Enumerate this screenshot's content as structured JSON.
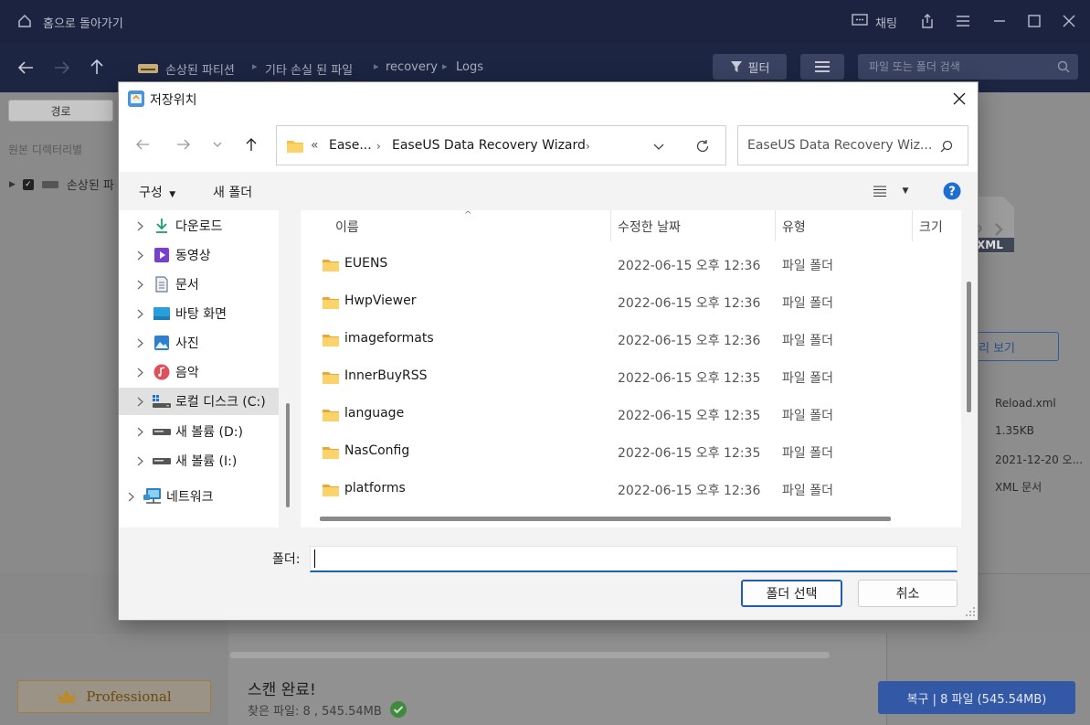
{
  "app": {
    "home_label": "홈으로 돌아가기",
    "chat_label": "채팅",
    "breadcrumb": [
      "손상된 파티션",
      "기타 손실 된 파일",
      "recovery",
      "Logs"
    ],
    "filter_label": "필터",
    "search_placeholder": "파일 또는 폴더 검색",
    "path_tab": "경로",
    "source_dir_label": "원본 디렉터리별",
    "tree_root_label": "손상된 파",
    "preview_label": "리 보기",
    "file_meta": {
      "name": "Reload.xml",
      "size": "1.35KB",
      "date": "2021-12-20 오...",
      "type": "XML 문서",
      "badge": "XML"
    },
    "professional_label": "Professional",
    "scan_title": "스캔 완료!",
    "scan_sub": "찾은 파일: 8 , 545.54MB",
    "recover_button": "복구 | 8 파일 (545.54MB)"
  },
  "dialog": {
    "title": "저장위치",
    "address": {
      "prefix": "«",
      "crumbs": [
        "Ease...",
        "EaseUS Data Recovery Wizard"
      ]
    },
    "search_placeholder": "EaseUS Data Recovery Wiz...",
    "organize_label": "구성",
    "new_folder_label": "새 폴더",
    "tree": [
      {
        "label": "다운로드",
        "icon": "download-icon",
        "color": "#1a9e6a"
      },
      {
        "label": "동영상",
        "icon": "video-icon",
        "color": "#7b3fd0"
      },
      {
        "label": "문서",
        "icon": "document-icon",
        "color": "#6b7a8c"
      },
      {
        "label": "바탕 화면",
        "icon": "desktop-icon",
        "color": "#2a9ed8"
      },
      {
        "label": "사진",
        "icon": "pictures-icon",
        "color": "#2e7fd1"
      },
      {
        "label": "음악",
        "icon": "music-icon",
        "color": "#e0505a"
      },
      {
        "label": "로컬 디스크 (C:)",
        "icon": "local-disk-icon",
        "color": "#555555",
        "selected": true
      },
      {
        "label": "새 볼륨 (D:)",
        "icon": "drive-icon",
        "color": "#555555"
      },
      {
        "label": "새 볼륨 (I:)",
        "icon": "drive-icon",
        "color": "#555555"
      },
      {
        "label": "네트워크",
        "icon": "network-icon",
        "color": "#2a7fc0"
      }
    ],
    "columns": {
      "name": "이름",
      "date": "수정한 날짜",
      "type": "유형",
      "size": "크기"
    },
    "files": [
      {
        "name": "EUENS",
        "date": "2022-06-15 오후 12:36",
        "type": "파일 폴더"
      },
      {
        "name": "HwpViewer",
        "date": "2022-06-15 오후 12:36",
        "type": "파일 폴더"
      },
      {
        "name": "imageformats",
        "date": "2022-06-15 오후 12:36",
        "type": "파일 폴더"
      },
      {
        "name": "InnerBuyRSS",
        "date": "2022-06-15 오후 12:35",
        "type": "파일 폴더"
      },
      {
        "name": "language",
        "date": "2022-06-15 오후 12:35",
        "type": "파일 폴더"
      },
      {
        "name": "NasConfig",
        "date": "2022-06-15 오후 12:35",
        "type": "파일 폴더"
      },
      {
        "name": "platforms",
        "date": "2022-06-15 오후 12:36",
        "type": "파일 폴더"
      }
    ],
    "folder_label": "폴더:",
    "folder_value": "",
    "ok_button": "폴더 선택",
    "cancel_button": "취소"
  },
  "colors": {
    "app_dark": "#1b2340",
    "accent_blue": "#1f5fb0",
    "folder_yellow": "#f6c14b"
  }
}
